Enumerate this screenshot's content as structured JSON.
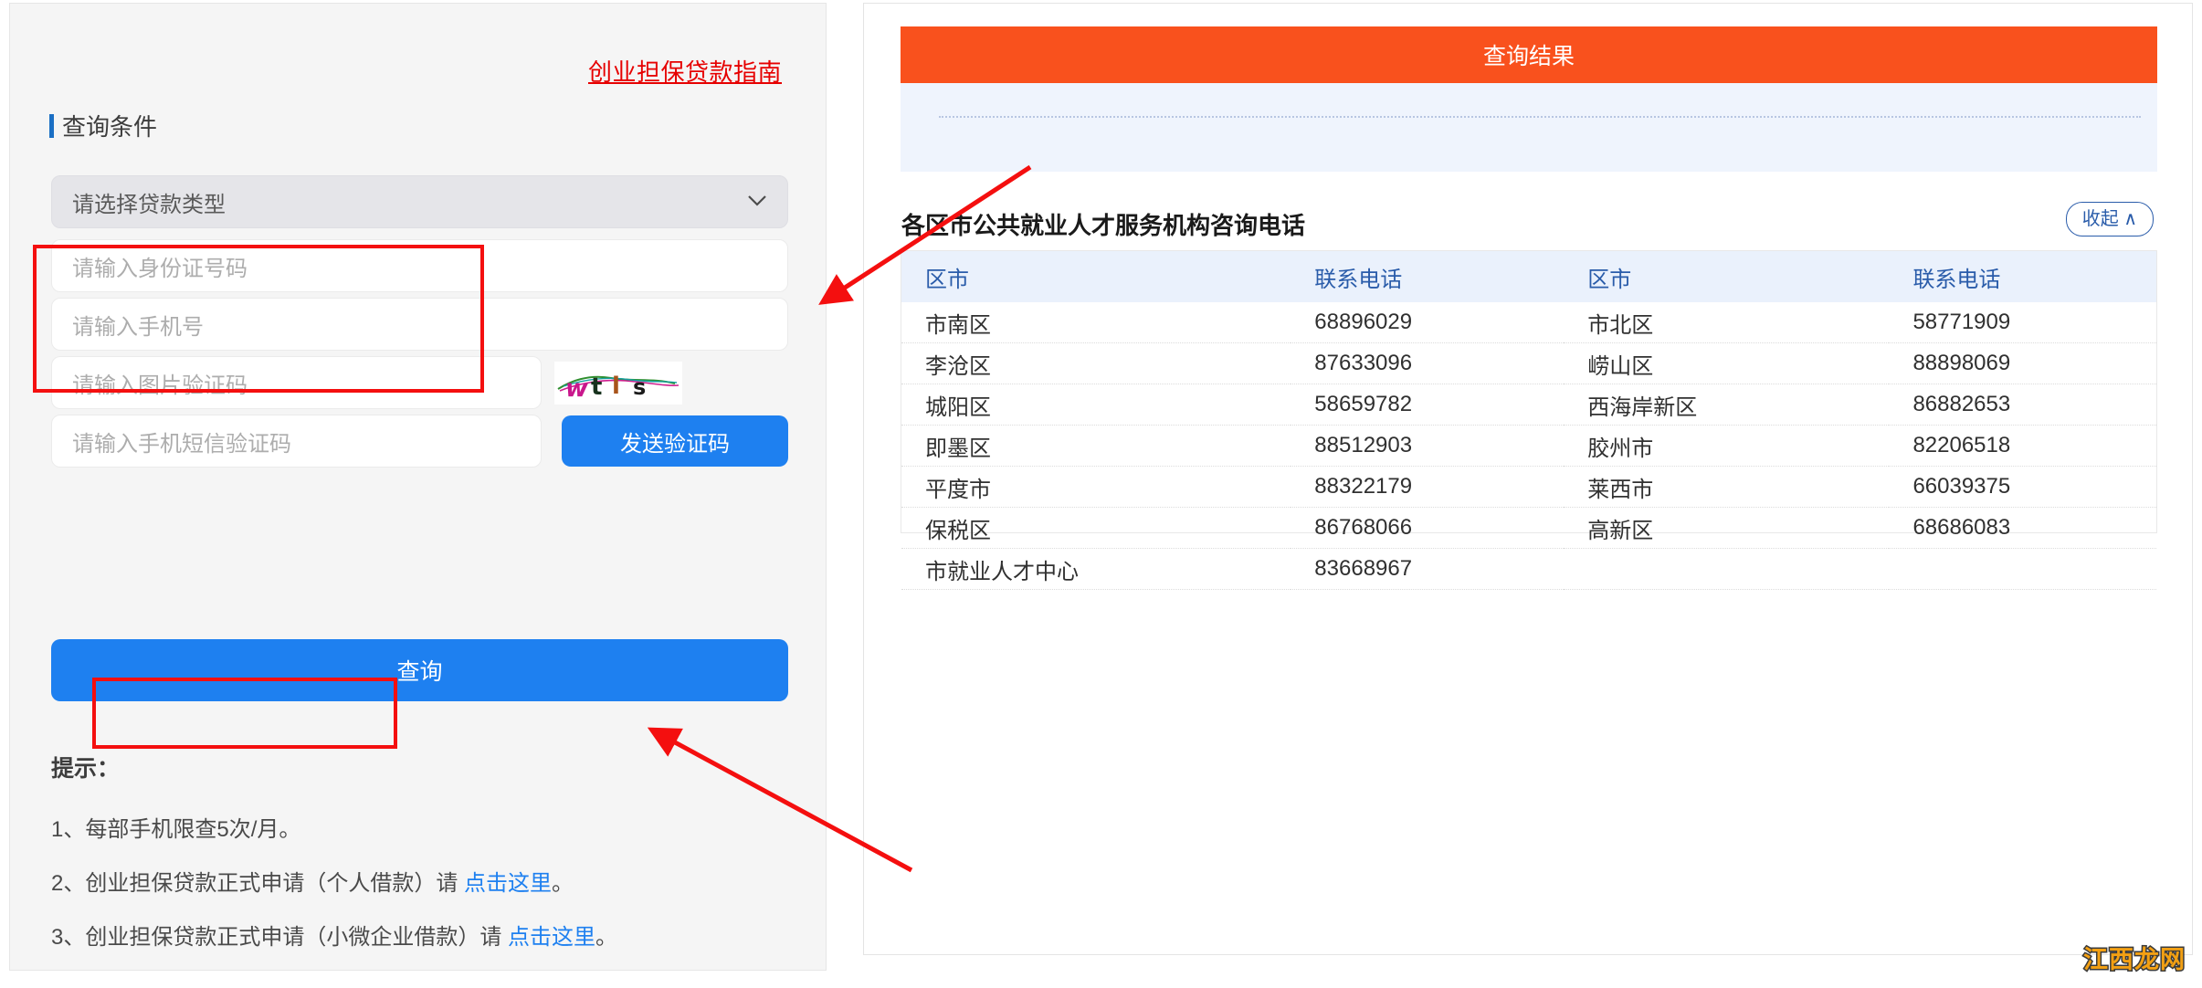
{
  "left": {
    "guide_link": "创业担保贷款指南",
    "section_title": "查询条件",
    "loan_type_placeholder": "请选择贷款类型",
    "id_placeholder": "请输入身份证号码",
    "phone_placeholder": "请输入手机号",
    "image_captcha_placeholder": "请输入图片验证码",
    "sms_placeholder": "请输入手机短信验证码",
    "send_code_label": "发送验证码",
    "query_label": "查询",
    "captcha_text": "wtls",
    "tips_head": "提示：",
    "tips": [
      {
        "prefix": "1、每部手机限查5次/月。",
        "link": "",
        "suffix": ""
      },
      {
        "prefix": "2、创业担保贷款正式申请（个人借款）请 ",
        "link": "点击这里",
        "suffix": "。"
      },
      {
        "prefix": "3、创业担保贷款正式申请（小微企业借款）请 ",
        "link": "点击这里",
        "suffix": "。"
      }
    ]
  },
  "right": {
    "result_header": "查询结果",
    "table_title": "各区市公共就业人才服务机构咨询电话",
    "collapse_label": "收起 ∧",
    "columns": [
      "区市",
      "联系电话",
      "区市",
      "联系电话"
    ],
    "rows": [
      [
        "市南区",
        "68896029",
        "市北区",
        "58771909"
      ],
      [
        "李沧区",
        "87633096",
        "崂山区",
        "88898069"
      ],
      [
        "城阳区",
        "58659782",
        "西海岸新区",
        "86882653"
      ],
      [
        "即墨区",
        "88512903",
        "胶州市",
        "82206518"
      ],
      [
        "平度市",
        "88322179",
        "莱西市",
        "66039375"
      ],
      [
        "保税区",
        "86768066",
        "高新区",
        "68686083"
      ],
      [
        "市就业人才中心",
        "83668967",
        "",
        ""
      ]
    ]
  },
  "watermark": "江西龙网",
  "colors": {
    "accent_blue": "#1e80f0",
    "header_orange": "#f9511d",
    "link_red": "#e60000",
    "table_header_blue": "#2a5caa",
    "annotation_red": "#f40f0f"
  }
}
